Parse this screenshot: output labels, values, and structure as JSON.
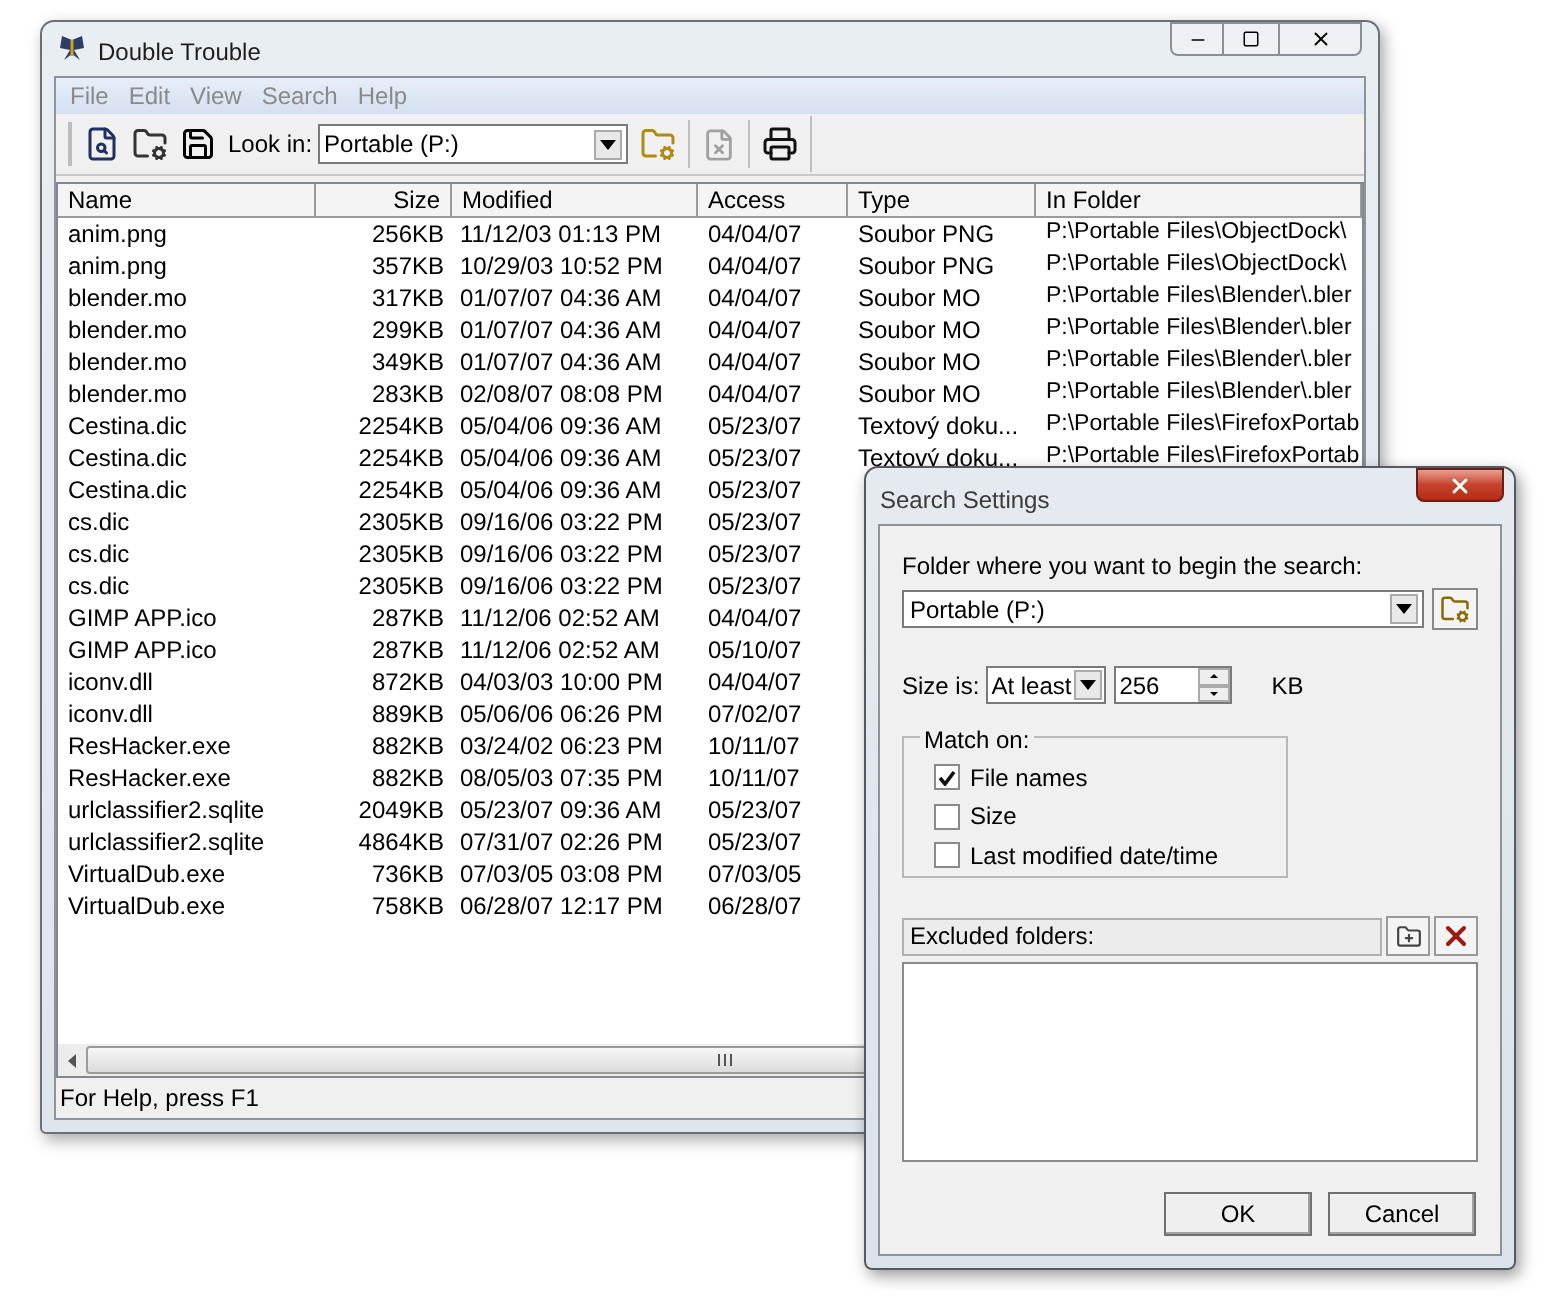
{
  "window": {
    "title": "Double Trouble"
  },
  "menu": [
    "File",
    "Edit",
    "View",
    "Search",
    "Help"
  ],
  "toolbar": {
    "look_in_label": "Look in:",
    "look_in_value": "Portable (P:)"
  },
  "table": {
    "columns": [
      "Name",
      "Size",
      "Modified",
      "Access",
      "Type",
      "In Folder"
    ],
    "rows": [
      {
        "name": "anim.png",
        "size": "256KB",
        "modified": "11/12/03 01:13 PM",
        "access": "04/04/07",
        "type": "Soubor PNG",
        "in_folder": "P:\\Portable Files\\ObjectDock\\"
      },
      {
        "name": "anim.png",
        "size": "357KB",
        "modified": "10/29/03 10:52 PM",
        "access": "04/04/07",
        "type": "Soubor PNG",
        "in_folder": "P:\\Portable Files\\ObjectDock\\"
      },
      {
        "name": "blender.mo",
        "size": "317KB",
        "modified": "01/07/07 04:36 AM",
        "access": "04/04/07",
        "type": "Soubor MO",
        "in_folder": "P:\\Portable Files\\Blender\\.bler"
      },
      {
        "name": "blender.mo",
        "size": "299KB",
        "modified": "01/07/07 04:36 AM",
        "access": "04/04/07",
        "type": "Soubor MO",
        "in_folder": "P:\\Portable Files\\Blender\\.bler"
      },
      {
        "name": "blender.mo",
        "size": "349KB",
        "modified": "01/07/07 04:36 AM",
        "access": "04/04/07",
        "type": "Soubor MO",
        "in_folder": "P:\\Portable Files\\Blender\\.bler"
      },
      {
        "name": "blender.mo",
        "size": "283KB",
        "modified": "02/08/07 08:08 PM",
        "access": "04/04/07",
        "type": "Soubor MO",
        "in_folder": "P:\\Portable Files\\Blender\\.bler"
      },
      {
        "name": "Cestina.dic",
        "size": "2254KB",
        "modified": "05/04/06 09:36 AM",
        "access": "05/23/07",
        "type": "Textový doku...",
        "in_folder": "P:\\Portable Files\\FirefoxPortab"
      },
      {
        "name": "Cestina.dic",
        "size": "2254KB",
        "modified": "05/04/06 09:36 AM",
        "access": "05/23/07",
        "type": "Textový doku...",
        "in_folder": "P:\\Portable Files\\FirefoxPortab"
      },
      {
        "name": "Cestina.dic",
        "size": "2254KB",
        "modified": "05/04/06 09:36 AM",
        "access": "05/23/07"
      },
      {
        "name": "cs.dic",
        "size": "2305KB",
        "modified": "09/16/06 03:22 PM",
        "access": "05/23/07"
      },
      {
        "name": "cs.dic",
        "size": "2305KB",
        "modified": "09/16/06 03:22 PM",
        "access": "05/23/07"
      },
      {
        "name": "cs.dic",
        "size": "2305KB",
        "modified": "09/16/06 03:22 PM",
        "access": "05/23/07"
      },
      {
        "name": "GIMP APP.ico",
        "size": "287KB",
        "modified": "11/12/06 02:52 AM",
        "access": "04/04/07"
      },
      {
        "name": "GIMP APP.ico",
        "size": "287KB",
        "modified": "11/12/06 02:52 AM",
        "access": "05/10/07"
      },
      {
        "name": "iconv.dll",
        "size": "872KB",
        "modified": "04/03/03 10:00 PM",
        "access": "04/04/07"
      },
      {
        "name": "iconv.dll",
        "size": "889KB",
        "modified": "05/06/06 06:26 PM",
        "access": "07/02/07"
      },
      {
        "name": "ResHacker.exe",
        "size": "882KB",
        "modified": "03/24/02 06:23 PM",
        "access": "10/11/07"
      },
      {
        "name": "ResHacker.exe",
        "size": "882KB",
        "modified": "08/05/03 07:35 PM",
        "access": "10/11/07"
      },
      {
        "name": "urlclassifier2.sqlite",
        "size": "2049KB",
        "modified": "05/23/07 09:36 AM",
        "access": "05/23/07"
      },
      {
        "name": "urlclassifier2.sqlite",
        "size": "4864KB",
        "modified": "07/31/07 02:26 PM",
        "access": "05/23/07"
      },
      {
        "name": "VirtualDub.exe",
        "size": "736KB",
        "modified": "07/03/05 03:08 PM",
        "access": "07/03/05"
      },
      {
        "name": "VirtualDub.exe",
        "size": "758KB",
        "modified": "06/28/07 12:17 PM",
        "access": "06/28/07"
      }
    ]
  },
  "status_bar": "For Help, press F1",
  "dialog": {
    "title": "Search Settings",
    "folder_label": "Folder where you want to begin the search:",
    "folder_value": "Portable (P:)",
    "size_label": "Size is:",
    "size_mode": "At least",
    "size_value": "256",
    "size_unit": "KB",
    "match_title": "Match on:",
    "match_options": [
      {
        "label": "File names",
        "checked": true
      },
      {
        "label": "Size",
        "checked": false
      },
      {
        "label": "Last modified date/time",
        "checked": false
      }
    ],
    "excluded_label": "Excluded folders:",
    "buttons": [
      "OK",
      "Cancel"
    ]
  }
}
